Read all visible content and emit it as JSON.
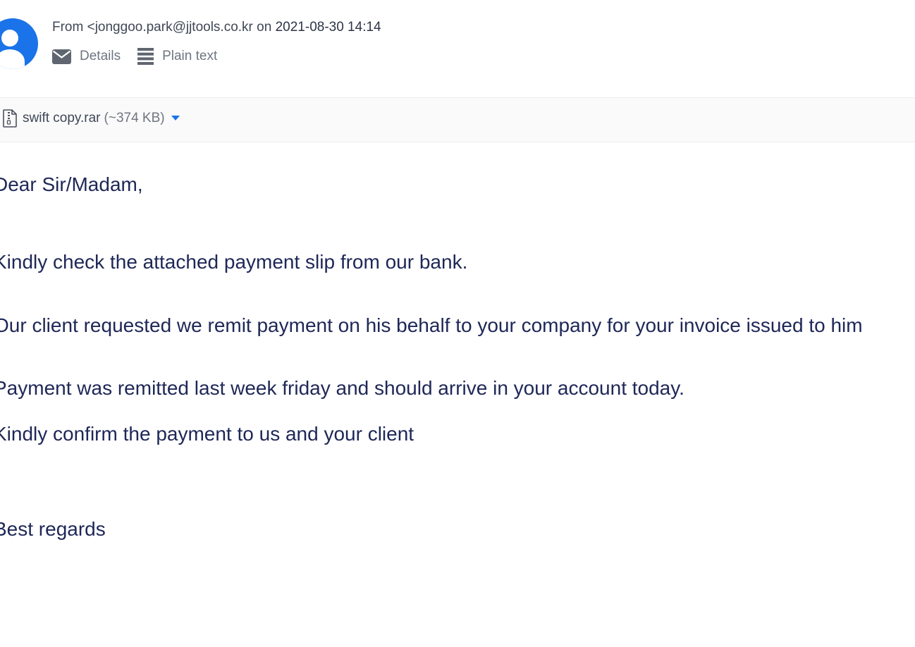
{
  "header": {
    "from_prefix": "From",
    "from_address": "<jonggoo.park@jjtools.co.kr",
    "on_word": "on",
    "date": "2021-08-30 14:14",
    "actions": [
      {
        "label": "Details",
        "icon": "envelope-icon"
      },
      {
        "label": "Plain text",
        "icon": "lines-icon"
      }
    ]
  },
  "attachment": {
    "filename": "swift copy.rar",
    "size": "(~374 KB)",
    "icon": "zip-file-icon"
  },
  "body": {
    "greeting": "Dear Sir/Madam,",
    "line1": "Kindly check the attached payment slip from our bank.",
    "line2": "Our client requested we remit payment on his behalf to your company for your invoice issued to him",
    "line3": "Payment was remitted last week friday and should arrive in your account today.",
    "line4": "Kindly confirm the payment to us and your client",
    "signoff": "Best regards"
  },
  "colors": {
    "accent": "#1a73e8",
    "body_text": "#1e2757",
    "meta_text": "#3f4756",
    "muted_text": "#6f7580"
  }
}
